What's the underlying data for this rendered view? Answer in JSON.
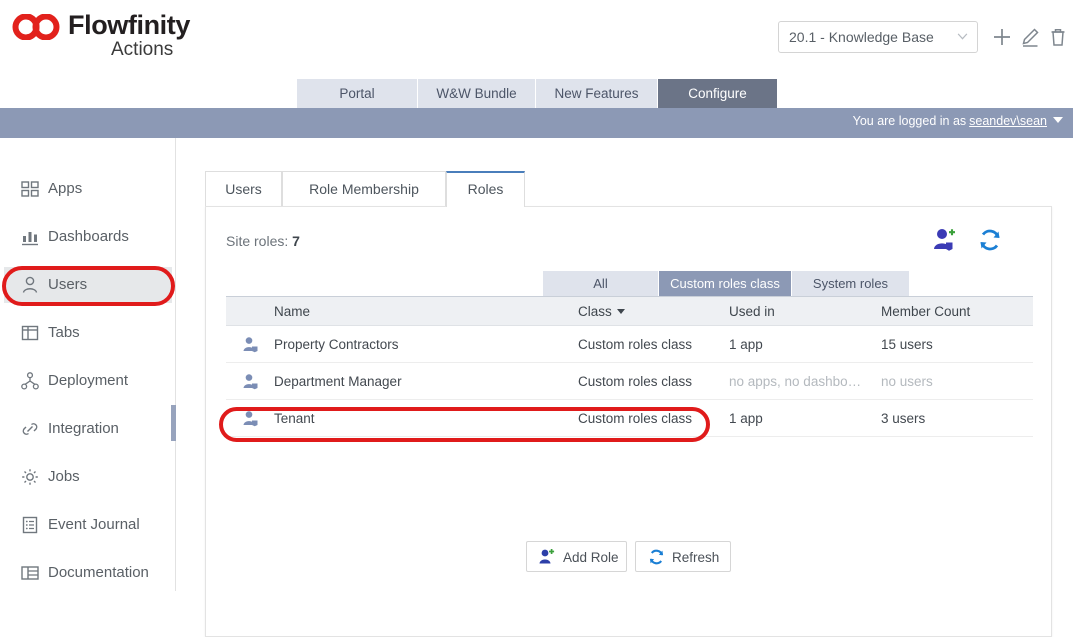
{
  "header": {
    "logo_name": "Flowfinity",
    "logo_sub": "Actions",
    "app_selector": {
      "value": "20.1 - Knowledge Base",
      "chevron_icon": "chevron-down-icon"
    },
    "actions": [
      {
        "icon": "plus-icon",
        "name": "add-app-button"
      },
      {
        "icon": "pencil-icon",
        "name": "edit-app-button"
      },
      {
        "icon": "trash-icon",
        "name": "delete-app-button"
      }
    ]
  },
  "nav_tabs": [
    {
      "label": "Portal",
      "active": false
    },
    {
      "label": "W&W Bundle",
      "active": false
    },
    {
      "label": "New Features",
      "active": false
    },
    {
      "label": "Configure",
      "active": true
    }
  ],
  "user_bar": {
    "prefix": "You are logged in as",
    "username": "seandev\\sean",
    "caret_icon": "caret-down-icon"
  },
  "sidebar": {
    "items": [
      {
        "label": "Apps",
        "icon": "grid-icon",
        "active": false
      },
      {
        "label": "Dashboards",
        "icon": "bar-chart-icon",
        "active": false
      },
      {
        "label": "Users",
        "icon": "user-icon",
        "active": true
      },
      {
        "label": "Tabs",
        "icon": "layout-panel-icon",
        "active": false
      },
      {
        "label": "Deployment",
        "icon": "network-nodes-icon",
        "active": false
      },
      {
        "label": "Integration",
        "icon": "link-icon",
        "active": false
      },
      {
        "label": "Jobs",
        "icon": "gear-icon",
        "active": false
      },
      {
        "label": "Event Journal",
        "icon": "journal-list-icon",
        "active": false
      },
      {
        "label": "Documentation",
        "icon": "book-grid-icon",
        "active": false
      }
    ]
  },
  "content": {
    "tabs": [
      {
        "label": "Users",
        "active": false
      },
      {
        "label": "Role Membership",
        "active": false
      },
      {
        "label": "Roles",
        "active": true
      }
    ],
    "site_roles_label": "Site roles:",
    "site_roles_count": "7",
    "toolbar": [
      {
        "icon": "add-role-icon",
        "name": "add-role-icon-button"
      },
      {
        "icon": "refresh-icon",
        "name": "refresh-icon-button"
      }
    ],
    "filters": [
      {
        "label": "All",
        "active": false
      },
      {
        "label": "Custom roles class",
        "active": true
      },
      {
        "label": "System roles",
        "active": false
      }
    ],
    "table": {
      "columns": [
        "Name",
        "Class",
        "Used in",
        "Member Count"
      ],
      "sorted_column": "Class",
      "sort_direction": "desc",
      "sort_caret_icon": "caret-down-icon",
      "rows": [
        {
          "icon": "role-user-icon",
          "name": "Property Contractors",
          "class": "Custom roles class",
          "used_in": "1 app",
          "member_count": "15 users",
          "muted": false,
          "highlighted": false
        },
        {
          "icon": "role-user-icon",
          "name": "Department Manager",
          "class": "Custom roles class",
          "used_in": "no apps, no dashbo…",
          "member_count": "no users",
          "muted": true,
          "highlighted": false
        },
        {
          "icon": "role-user-icon",
          "name": "Tenant",
          "class": "Custom roles class",
          "used_in": "1 app",
          "member_count": "3 users",
          "muted": false,
          "highlighted": true
        }
      ]
    },
    "footer_buttons": [
      {
        "label": "Add Role",
        "icon": "add-role-icon"
      },
      {
        "label": "Refresh",
        "icon": "refresh-icon"
      }
    ]
  },
  "annotations": {
    "color": "#e01b1b",
    "shapes": [
      "oval-around-sidebar-users",
      "oval-around-tenant-row"
    ]
  }
}
